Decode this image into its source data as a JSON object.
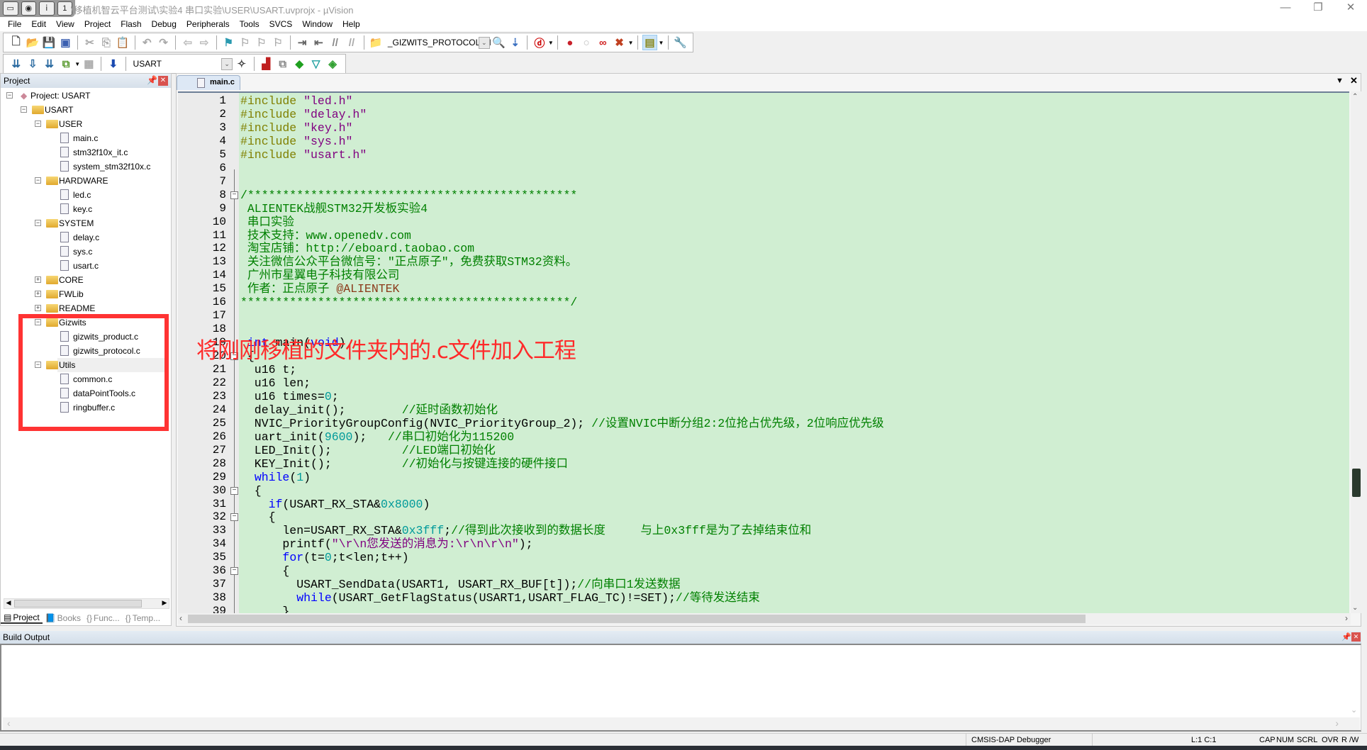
{
  "window": {
    "title": "\\移植机智云平台测试\\实验4 串口实验\\USER\\USART.uvprojx - µVision",
    "controls": [
      "minimize",
      "restore",
      "close"
    ]
  },
  "menu": [
    "File",
    "Edit",
    "View",
    "Project",
    "Flash",
    "Debug",
    "Peripherals",
    "Tools",
    "SVCS",
    "Window",
    "Help"
  ],
  "toolbar1": {
    "items": [
      {
        "icon": "new-file",
        "glyph": "🗋",
        "color": "#555"
      },
      {
        "icon": "open-folder",
        "glyph": "📂",
        "color": "#d9a020"
      },
      {
        "icon": "save",
        "glyph": "💾",
        "color": "#2a4f9a"
      },
      {
        "icon": "save-all",
        "glyph": "▣",
        "color": "#3a5fb0"
      },
      {
        "sep": true
      },
      {
        "icon": "cut",
        "glyph": "✂",
        "color": "#aaa"
      },
      {
        "icon": "copy",
        "glyph": "⎘",
        "color": "#aaa"
      },
      {
        "icon": "paste",
        "glyph": "📋",
        "color": "#c8902a"
      },
      {
        "sep": true
      },
      {
        "icon": "undo",
        "glyph": "↶",
        "color": "#aaa"
      },
      {
        "icon": "redo",
        "glyph": "↷",
        "color": "#aaa"
      },
      {
        "sep": true
      },
      {
        "icon": "navigate-back",
        "glyph": "⇦",
        "color": "#bbb"
      },
      {
        "icon": "navigate-forward",
        "glyph": "⇨",
        "color": "#bbb"
      },
      {
        "sep": true
      },
      {
        "icon": "bookmark-toggle",
        "glyph": "⚑",
        "color": "#2a9ab0"
      },
      {
        "icon": "bookmark-previous",
        "glyph": "⚐",
        "color": "#aaa"
      },
      {
        "icon": "bookmark-next",
        "glyph": "⚐",
        "color": "#aaa"
      },
      {
        "icon": "bookmark-clear",
        "glyph": "⚐",
        "color": "#aaa"
      },
      {
        "sep": true
      },
      {
        "icon": "indent",
        "glyph": "⇥",
        "color": "#666"
      },
      {
        "icon": "unindent",
        "glyph": "⇤",
        "color": "#666"
      },
      {
        "icon": "comment",
        "glyph": "//",
        "color": "#888"
      },
      {
        "icon": "uncomment",
        "glyph": "//",
        "color": "#aaa"
      },
      {
        "sep": true
      },
      {
        "icon": "find-in-files",
        "glyph": "📁",
        "color": "#c8902a"
      },
      {
        "combo": "_GIZWITS_PROTOCOL_H"
      },
      {
        "icon": "find",
        "glyph": "🔍",
        "color": "#3a6fc0"
      },
      {
        "icon": "incremental-find",
        "glyph": "⇣",
        "color": "#3a6fc0"
      },
      {
        "sep": true
      },
      {
        "icon": "debug-session",
        "glyph": "ⓓ",
        "color": "#c00"
      },
      {
        "drop": true
      },
      {
        "sep": true
      },
      {
        "icon": "breakpoint-insert",
        "glyph": "●",
        "color": "#c8202a"
      },
      {
        "icon": "breakpoint-disable",
        "glyph": "○",
        "color": "#bbb"
      },
      {
        "icon": "breakpoint-disable-all",
        "glyph": "∞",
        "color": "#d02020"
      },
      {
        "icon": "breakpoint-kill-all",
        "glyph": "✖",
        "color": "#c04020"
      },
      {
        "drop": true
      },
      {
        "sep": true
      },
      {
        "icon": "window-layout",
        "glyph": "▤",
        "color": "#8a8a20",
        "highlight": true
      },
      {
        "drop": true
      },
      {
        "sep": true
      },
      {
        "icon": "configure",
        "glyph": "🔧",
        "color": "#3a5a9a"
      }
    ]
  },
  "toolbar2": {
    "items": [
      {
        "icon": "translate",
        "glyph": "⇊",
        "color": "#2a6aa0"
      },
      {
        "icon": "build",
        "glyph": "⇩",
        "color": "#2a6aa0"
      },
      {
        "icon": "rebuild",
        "glyph": "⇊",
        "color": "#2a6aa0"
      },
      {
        "icon": "batch-build",
        "glyph": "⧉",
        "color": "#5a9a30"
      },
      {
        "drop": true
      },
      {
        "icon": "stop-build",
        "glyph": "▦",
        "color": "#aaa"
      },
      {
        "sep": true
      },
      {
        "icon": "load-download",
        "glyph": "⬇",
        "color": "#1a4ab0"
      },
      {
        "sep": true
      },
      {
        "combo": "USART"
      },
      {
        "icon": "options-for-target",
        "glyph": "✧",
        "color": "#444"
      },
      {
        "sep": true
      },
      {
        "icon": "manage-project-items",
        "glyph": "▟",
        "color": "#c02020"
      },
      {
        "icon": "select-packs",
        "glyph": "⧉",
        "color": "#888"
      },
      {
        "icon": "manage-run-time-environment",
        "glyph": "◆",
        "color": "#20a020"
      },
      {
        "icon": "pack-installer",
        "glyph": "▽",
        "color": "#20a0a0"
      },
      {
        "icon": "software-packs",
        "glyph": "◈",
        "color": "#30a030"
      }
    ]
  },
  "project_panel": {
    "title": "Project",
    "tree": [
      {
        "label": "Project: USART",
        "level": 0,
        "type": "project",
        "expanded": true
      },
      {
        "label": "USART",
        "level": 1,
        "type": "target",
        "expanded": true
      },
      {
        "label": "USER",
        "level": 2,
        "type": "folder",
        "expanded": true
      },
      {
        "label": "main.c",
        "level": 3,
        "type": "file"
      },
      {
        "label": "stm32f10x_it.c",
        "level": 3,
        "type": "file"
      },
      {
        "label": "system_stm32f10x.c",
        "level": 3,
        "type": "file"
      },
      {
        "label": "HARDWARE",
        "level": 2,
        "type": "folder",
        "expanded": true
      },
      {
        "label": "led.c",
        "level": 3,
        "type": "file"
      },
      {
        "label": "key.c",
        "level": 3,
        "type": "file"
      },
      {
        "label": "SYSTEM",
        "level": 2,
        "type": "folder",
        "expanded": true
      },
      {
        "label": "delay.c",
        "level": 3,
        "type": "file"
      },
      {
        "label": "sys.c",
        "level": 3,
        "type": "file"
      },
      {
        "label": "usart.c",
        "level": 3,
        "type": "file"
      },
      {
        "label": "CORE",
        "level": 2,
        "type": "folder",
        "expanded": false
      },
      {
        "label": "FWLib",
        "level": 2,
        "type": "folder",
        "expanded": false
      },
      {
        "label": "README",
        "level": 2,
        "type": "folder",
        "expanded": false
      },
      {
        "label": "Gizwits",
        "level": 2,
        "type": "folder",
        "expanded": true
      },
      {
        "label": "gizwits_product.c",
        "level": 3,
        "type": "file"
      },
      {
        "label": "gizwits_protocol.c",
        "level": 3,
        "type": "file"
      },
      {
        "label": "Utils",
        "level": 2,
        "type": "folder",
        "expanded": true,
        "selected": true
      },
      {
        "label": "common.c",
        "level": 3,
        "type": "file"
      },
      {
        "label": "dataPointTools.c",
        "level": 3,
        "type": "file"
      },
      {
        "label": "ringbuffer.c",
        "level": 3,
        "type": "file"
      }
    ],
    "tabs": [
      {
        "label": "Project",
        "active": true
      },
      {
        "label": "Books"
      },
      {
        "label": "Func..."
      },
      {
        "label": "Temp..."
      }
    ]
  },
  "annotation": {
    "text": "将刚刚移植的文件夹内的.c文件加入工程",
    "color": "#ff2a2a"
  },
  "editor": {
    "tab": "main.c",
    "background": "#d0eed2",
    "fold_lines": [
      8,
      20,
      30,
      32,
      36
    ],
    "lines": [
      [
        [
          "p",
          "#include "
        ],
        [
          "s",
          "\"led.h\""
        ]
      ],
      [
        [
          "p",
          "#include "
        ],
        [
          "s",
          "\"delay.h\""
        ]
      ],
      [
        [
          "p",
          "#include "
        ],
        [
          "s",
          "\"key.h\""
        ]
      ],
      [
        [
          "p",
          "#include "
        ],
        [
          "s",
          "\"sys.h\""
        ]
      ],
      [
        [
          "p",
          "#include "
        ],
        [
          "s",
          "\"usart.h\""
        ]
      ],
      [],
      [],
      [
        [
          "c",
          "/***********************************************"
        ]
      ],
      [
        [
          "c",
          " ALIENTEK战舰STM32开发板实验4"
        ]
      ],
      [
        [
          "c",
          " 串口实验"
        ]
      ],
      [
        [
          "c",
          " 技术支持：www.openedv.com"
        ]
      ],
      [
        [
          "c",
          " 淘宝店铺：http://eboard.taobao.com"
        ]
      ],
      [
        [
          "c",
          " 关注微信公众平台微信号：\"正点原子\"，免费获取STM32资料。"
        ]
      ],
      [
        [
          "c",
          " 广州市星翼电子科技有限公司"
        ]
      ],
      [
        [
          "c",
          " 作者：正点原子 "
        ],
        [
          "d",
          "@ALIENTEK"
        ]
      ],
      [
        [
          "c",
          "***********************************************/"
        ]
      ],
      [],
      [],
      [
        [
          "t",
          " "
        ],
        [
          "k",
          "int"
        ],
        [
          "t",
          " main("
        ],
        [
          "k",
          "void"
        ],
        [
          "t",
          ")"
        ]
      ],
      [
        [
          "t",
          " {"
        ]
      ],
      [
        [
          "t",
          "  u16 t;"
        ]
      ],
      [
        [
          "t",
          "  u16 len;"
        ]
      ],
      [
        [
          "t",
          "  u16 times="
        ],
        [
          "n",
          "0"
        ],
        [
          "t",
          ";"
        ]
      ],
      [
        [
          "t",
          "  delay_init();        "
        ],
        [
          "c",
          "//延时函数初始化"
        ]
      ],
      [
        [
          "t",
          "  NVIC_PriorityGroupConfig(NVIC_PriorityGroup_2); "
        ],
        [
          "c",
          "//设置NVIC中断分组2:2位抢占优先级，2位响应优先级"
        ]
      ],
      [
        [
          "t",
          "  uart_init("
        ],
        [
          "n",
          "9600"
        ],
        [
          "t",
          ");   "
        ],
        [
          "c",
          "//串口初始化为115200"
        ]
      ],
      [
        [
          "t",
          "  LED_Init();          "
        ],
        [
          "c",
          "//LED端口初始化"
        ]
      ],
      [
        [
          "t",
          "  KEY_Init();          "
        ],
        [
          "c",
          "//初始化与按键连接的硬件接口"
        ]
      ],
      [
        [
          "t",
          "  "
        ],
        [
          "k",
          "while"
        ],
        [
          "t",
          "("
        ],
        [
          "n",
          "1"
        ],
        [
          "t",
          ")"
        ]
      ],
      [
        [
          "t",
          "  {"
        ]
      ],
      [
        [
          "t",
          "    "
        ],
        [
          "k",
          "if"
        ],
        [
          "t",
          "(USART_RX_STA&"
        ],
        [
          "n",
          "0x8000"
        ],
        [
          "t",
          ")"
        ]
      ],
      [
        [
          "t",
          "    {"
        ]
      ],
      [
        [
          "t",
          "      len=USART_RX_STA&"
        ],
        [
          "n",
          "0x3fff"
        ],
        [
          "t",
          ";"
        ],
        [
          "c",
          "//得到此次接收到的数据长度     与上0x3fff是为了去掉结束位和"
        ]
      ],
      [
        [
          "t",
          "      printf("
        ],
        [
          "s",
          "\"\\r\\n您发送的消息为:\\r\\n\\r\\n\""
        ],
        [
          "t",
          ");"
        ]
      ],
      [
        [
          "t",
          "      "
        ],
        [
          "k",
          "for"
        ],
        [
          "t",
          "(t="
        ],
        [
          "n",
          "0"
        ],
        [
          "t",
          ";t<len;t++)"
        ]
      ],
      [
        [
          "t",
          "      {"
        ]
      ],
      [
        [
          "t",
          "        USART_SendData(USART1, USART_RX_BUF[t]);"
        ],
        [
          "c",
          "//向串口1发送数据"
        ]
      ],
      [
        [
          "t",
          "        "
        ],
        [
          "k",
          "while"
        ],
        [
          "t",
          "(USART_GetFlagStatus(USART1,USART_FLAG_TC)!=SET);"
        ],
        [
          "c",
          "//等待发送结束"
        ]
      ],
      [
        [
          "t",
          "      }"
        ]
      ]
    ]
  },
  "build_output": {
    "title": "Build Output"
  },
  "status_bar": {
    "debugger": "CMSIS-DAP Debugger",
    "position": "L:1 C:1",
    "cap": "CAP",
    "num": "NUM",
    "scrl": "SCRL",
    "ovr": "OVR",
    "rw": "R /W"
  }
}
